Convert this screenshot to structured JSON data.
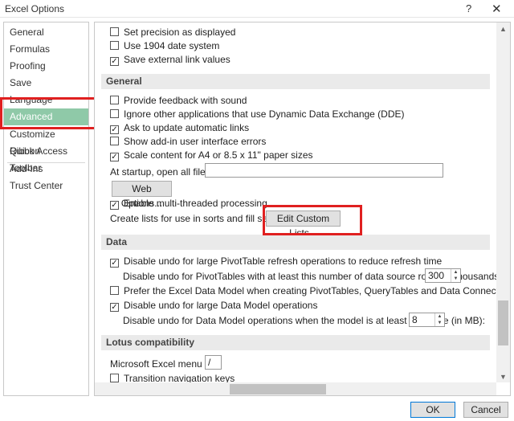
{
  "window": {
    "title": "Excel Options",
    "help_icon": "?",
    "close_icon": "✕"
  },
  "sidebar": {
    "items": [
      {
        "label": "General"
      },
      {
        "label": "Formulas"
      },
      {
        "label": "Proofing"
      },
      {
        "label": "Save"
      },
      {
        "label": "Language"
      },
      {
        "label": "Advanced",
        "active": true
      },
      {
        "label": "Customize Ribbon"
      },
      {
        "label": "Quick Access Toolbar"
      },
      {
        "label": "Add-Ins"
      },
      {
        "label": "Trust Center"
      }
    ]
  },
  "top_options": {
    "set_precision": {
      "label": "Set precision as displayed",
      "checked": false
    },
    "use_1904": {
      "label": "Use 1904 date system",
      "checked": false
    },
    "save_external_links": {
      "label": "Save external link values",
      "checked": true
    }
  },
  "general": {
    "header": "General",
    "provide_feedback": {
      "label": "Provide feedback with sound",
      "checked": false
    },
    "ignore_dde": {
      "label": "Ignore other applications that use Dynamic Data Exchange (DDE)",
      "checked": false
    },
    "ask_update_links": {
      "label": "Ask to update automatic links",
      "checked": true
    },
    "show_addin_errors": {
      "label": "Show add-in user interface errors",
      "checked": false
    },
    "scale_content": {
      "label": "Scale content for A4 or 8.5 x 11\" paper sizes",
      "checked": true
    },
    "startup_label": "At startup, open all files in:",
    "startup_value": "",
    "web_options_button": "Web Options...",
    "multithreaded": {
      "label": "Enable multi-threaded processing",
      "checked": true
    },
    "create_lists_label": "Create lists for use in sorts and fill sequences:",
    "edit_custom_lists_button": "Edit Custom Lists..."
  },
  "data": {
    "header": "Data",
    "disable_undo_pivot": {
      "label": "Disable undo for large PivotTable refresh operations to reduce refresh time",
      "checked": true
    },
    "pivot_rows_label": "Disable undo for PivotTables with at least this number of data source rows (in thousands):",
    "pivot_rows_value": "300",
    "prefer_data_model": {
      "label": "Prefer the Excel Data Model when creating PivotTables, QueryTables and Data Connections",
      "checked": false
    },
    "disable_undo_model": {
      "label": "Disable undo for large Data Model operations",
      "checked": true
    },
    "model_size_label": "Disable undo for Data Model operations when the model is at least this large (in MB):",
    "model_size_value": "8"
  },
  "lotus": {
    "header": "Lotus compatibility",
    "menu_key_label": "Microsoft Excel menu key:",
    "menu_key_value": "/",
    "transition_keys": {
      "label": "Transition navigation keys",
      "checked": false
    }
  },
  "footer": {
    "ok_label": "OK",
    "cancel_label": "Cancel"
  },
  "colors": {
    "accent": "#8fc9a8",
    "highlight": "#e02020",
    "section_bg": "#eaeaea"
  }
}
